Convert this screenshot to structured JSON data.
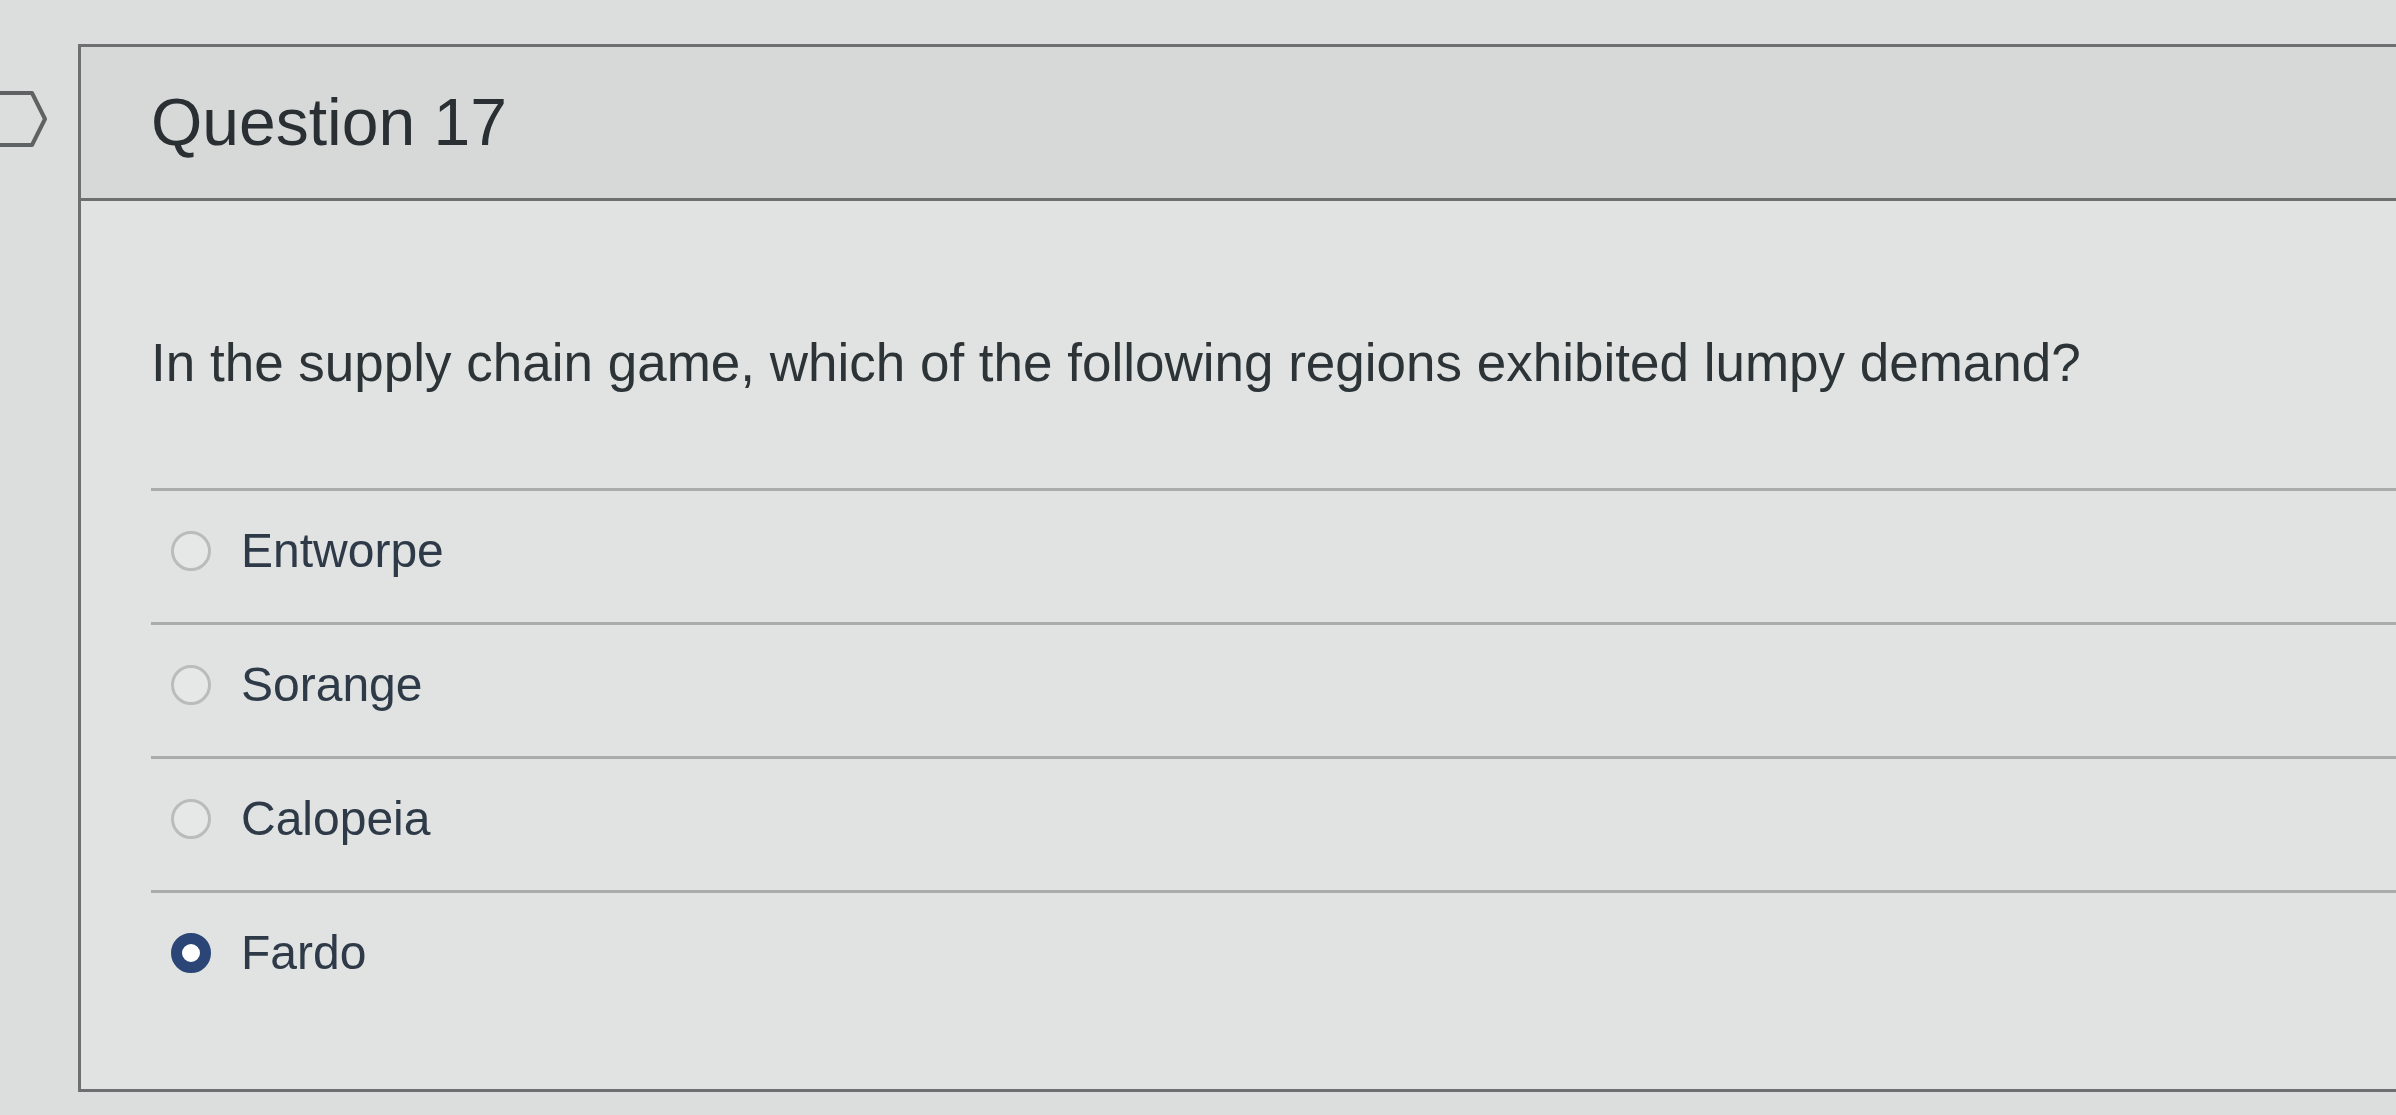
{
  "question": {
    "flagged": false,
    "title": "Question 17",
    "text": "In the supply chain game, which of the following regions exhibited lumpy demand?",
    "options": [
      {
        "label": "Entworpe",
        "selected": false
      },
      {
        "label": "Sorange",
        "selected": false
      },
      {
        "label": "Calopeia",
        "selected": false
      },
      {
        "label": "Fardo",
        "selected": true
      }
    ]
  }
}
